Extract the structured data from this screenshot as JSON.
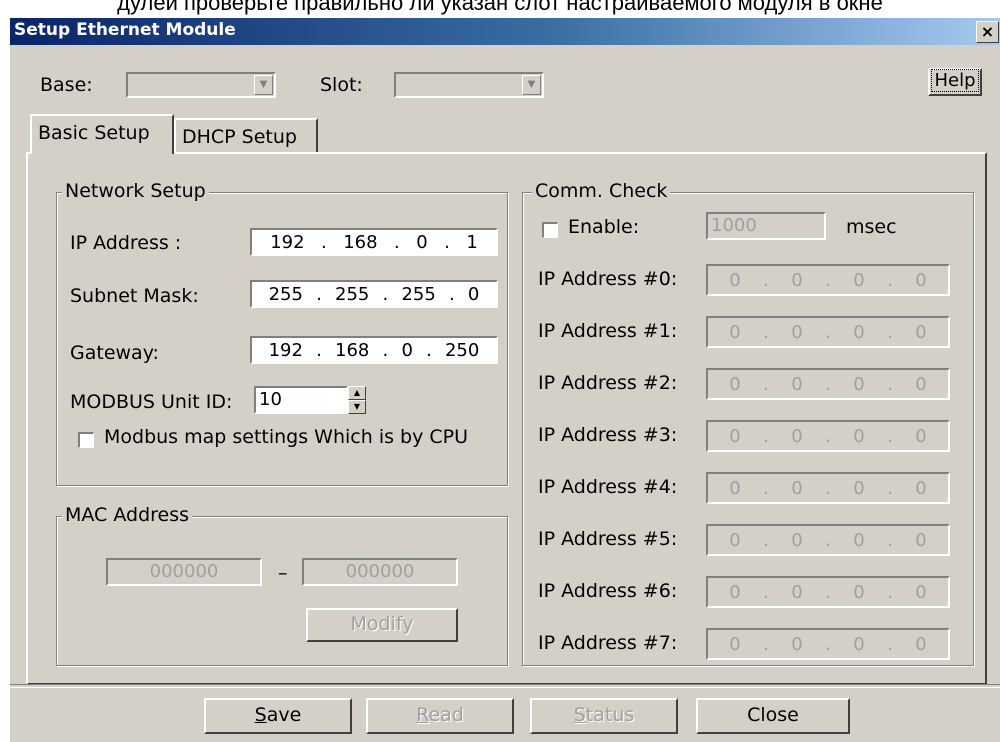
{
  "caption_text": "дулей проверьте правильно ли указан слот настраиваемого модуля в окне",
  "window": {
    "title": "Setup Ethernet Module",
    "close": "×"
  },
  "top": {
    "base_label": "Base:",
    "slot_label": "Slot:",
    "help_label": "Help"
  },
  "tabs": [
    {
      "label": "Basic Setup"
    },
    {
      "label": "DHCP Setup"
    }
  ],
  "network": {
    "legend": "Network Setup",
    "ip_label": "IP Address :",
    "ip": [
      "192",
      "168",
      "0",
      "1"
    ],
    "subnet_label": "Subnet Mask:",
    "subnet": [
      "255",
      "255",
      "255",
      "0"
    ],
    "gateway_label": "Gateway:",
    "gateway": [
      "192",
      "168",
      "0",
      "250"
    ],
    "modbus_label": "MODBUS Unit ID:",
    "modbus_value": "10",
    "modbus_map_label": "Modbus map settings Which is by CPU"
  },
  "mac": {
    "legend": "MAC Address",
    "part1": "000000",
    "dash": "–",
    "part2": "000000",
    "modify_label": "Modify"
  },
  "comm": {
    "legend": "Comm. Check",
    "enable_label": "Enable:",
    "enable_value": "1000",
    "unit": "msec",
    "addresses": [
      {
        "label": "IP Address #0:",
        "octets": [
          "0",
          "0",
          "0",
          "0"
        ]
      },
      {
        "label": "IP Address #1:",
        "octets": [
          "0",
          "0",
          "0",
          "0"
        ]
      },
      {
        "label": "IP Address #2:",
        "octets": [
          "0",
          "0",
          "0",
          "0"
        ]
      },
      {
        "label": "IP Address #3:",
        "octets": [
          "0",
          "0",
          "0",
          "0"
        ]
      },
      {
        "label": "IP Address #4:",
        "octets": [
          "0",
          "0",
          "0",
          "0"
        ]
      },
      {
        "label": "IP Address #5:",
        "octets": [
          "0",
          "0",
          "0",
          "0"
        ]
      },
      {
        "label": "IP Address #6:",
        "octets": [
          "0",
          "0",
          "0",
          "0"
        ]
      },
      {
        "label": "IP Address #7:",
        "octets": [
          "0",
          "0",
          "0",
          "0"
        ]
      }
    ]
  },
  "footer": {
    "save_label": "Save",
    "save_accel": "S",
    "save_rest": "ave",
    "read_label": "Read",
    "read_accel": "R",
    "read_rest": "ead",
    "status_label": "Status",
    "status_accel": "S",
    "status_rest": "tatus",
    "close_label": "Close"
  }
}
